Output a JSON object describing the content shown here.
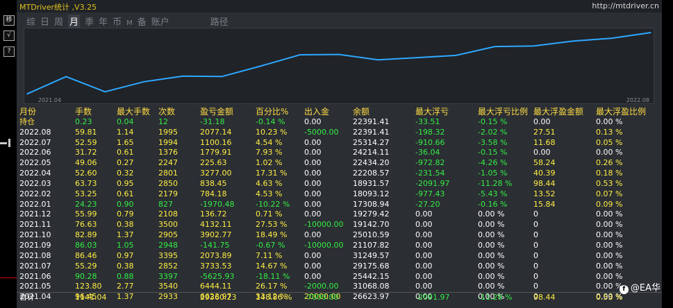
{
  "app": {
    "title": "MTDriver统计 ,V3.25",
    "link": "http://mtdriver.cn"
  },
  "rail_buttons": [
    "移",
    "√",
    "?"
  ],
  "tabs": [
    {
      "label": "综",
      "active": false
    },
    {
      "label": "日",
      "active": false
    },
    {
      "label": "周",
      "active": false
    },
    {
      "label": "月",
      "active": true
    },
    {
      "label": "季",
      "active": false
    },
    {
      "label": "年",
      "active": false
    },
    {
      "label": "币",
      "active": false
    },
    {
      "label": "M",
      "active": false
    },
    {
      "label": "备",
      "active": false
    },
    {
      "label": "账户",
      "active": false
    },
    {
      "label": "路径",
      "active": false
    }
  ],
  "chart_data": {
    "type": "line",
    "x_start_label": "2021.04",
    "x_end_label": "2022.08",
    "x": [
      "2021.04",
      "2021.05",
      "2021.06",
      "2021.07",
      "2021.08",
      "2021.09",
      "2021.10",
      "2021.11",
      "2021.12",
      "2022.01",
      "2022.02",
      "2022.03",
      "2022.04",
      "2022.05",
      "2022.06",
      "2022.07",
      "2022.08"
    ],
    "values": [
      6623.97,
      13068.08,
      7442.33,
      11175.86,
      13249.75,
      13108.0,
      17010.77,
      21142.88,
      21279.6,
      19309.12,
      20093.3,
      20931.75,
      24208.75,
      24434.38,
      26214.29,
      27314.4,
      29391.41
    ],
    "line_color": "#2ea8ff"
  },
  "table": {
    "headers": [
      "月份",
      "手数",
      "最大手数",
      "次数",
      "盈亏金额",
      "百分比%",
      "出入金",
      "余额",
      "最大浮亏",
      "最大浮亏比例",
      "最大浮盈金额",
      "最大浮盈比例"
    ],
    "rows": [
      {
        "cells": [
          "持仓",
          "0.23",
          "0.04",
          "12",
          "-31.18",
          "-0.14 %",
          "0.00",
          "22391.41",
          "-33.51",
          "-0.15 %",
          "0.00",
          "0.00 %"
        ],
        "colors": [
          "#ffdd44",
          "#33ee44",
          "#33ee44",
          "#33ee44",
          "#33ee44",
          "#33ee44",
          "#ffffff",
          "#ffffff",
          "#33ee44",
          "#33ee44",
          "#ffffff",
          "#ffffff"
        ]
      },
      {
        "cells": [
          "2022.08",
          "59.81",
          "1.14",
          "1995",
          "2077.14",
          "10.23 %",
          "-5000.00",
          "22391.41",
          "-198.32",
          "-2.02 %",
          "27.51",
          "0.13 %"
        ],
        "colors": [
          "#ffffff",
          "#ffee44",
          "#ffee44",
          "#ffee44",
          "#ffee44",
          "#ffee44",
          "#33ee44",
          "#ffffff",
          "#33ee44",
          "#33ee44",
          "#ffee44",
          "#ffee44"
        ]
      },
      {
        "cells": [
          "2022.07",
          "52.59",
          "1.65",
          "1994",
          "1100.16",
          "4.54 %",
          "0.00",
          "25314.27",
          "-910.66",
          "-3.58 %",
          "11.68",
          "0.05 %"
        ],
        "colors": [
          "#ffffff",
          "#ffee44",
          "#ffee44",
          "#ffee44",
          "#ffee44",
          "#ffee44",
          "#ffffff",
          "#ffffff",
          "#33ee44",
          "#33ee44",
          "#ffee44",
          "#ffee44"
        ]
      },
      {
        "cells": [
          "2022.06",
          "31.72",
          "0.61",
          "1376",
          "1779.91",
          "7.93 %",
          "0.00",
          "24214.11",
          "-36.04",
          "-0.15 %",
          "0.00",
          "0.00 %"
        ],
        "colors": [
          "#ffffff",
          "#ffee44",
          "#ffee44",
          "#ffee44",
          "#ffee44",
          "#ffee44",
          "#ffffff",
          "#ffffff",
          "#33ee44",
          "#33ee44",
          "#ffffff",
          "#ffffff"
        ]
      },
      {
        "cells": [
          "2022.05",
          "49.06",
          "0.27",
          "2247",
          "225.63",
          "1.02 %",
          "0.00",
          "22434.20",
          "-972.82",
          "-4.26 %",
          "58.24",
          "0.26 %"
        ],
        "colors": [
          "#ffffff",
          "#ffee44",
          "#ffee44",
          "#ffee44",
          "#ffee44",
          "#ffee44",
          "#ffffff",
          "#ffffff",
          "#33ee44",
          "#33ee44",
          "#ffee44",
          "#ffee44"
        ]
      },
      {
        "cells": [
          "2022.04",
          "52.60",
          "0.32",
          "2801",
          "3277.00",
          "17.31 %",
          "0.00",
          "22208.57",
          "-231.54",
          "-1.05 %",
          "40.39",
          "0.18 %"
        ],
        "colors": [
          "#ffffff",
          "#ffee44",
          "#ffee44",
          "#ffee44",
          "#ffee44",
          "#ffee44",
          "#ffffff",
          "#ffffff",
          "#33ee44",
          "#33ee44",
          "#ffee44",
          "#ffee44"
        ]
      },
      {
        "cells": [
          "2022.03",
          "63.73",
          "0.95",
          "2850",
          "838.45",
          "4.63 %",
          "0.00",
          "18931.57",
          "-2091.97",
          "-11.28 %",
          "98.44",
          "0.53 %"
        ],
        "colors": [
          "#ffffff",
          "#ffee44",
          "#ffee44",
          "#ffee44",
          "#ffee44",
          "#ffee44",
          "#ffffff",
          "#ffffff",
          "#33ee44",
          "#33ee44",
          "#ffee44",
          "#ffee44"
        ]
      },
      {
        "cells": [
          "2022.02",
          "53.25",
          "0.61",
          "2179",
          "784.18",
          "4.53 %",
          "0.00",
          "18093.12",
          "-977.43",
          "-5.43 %",
          "13.52",
          "0.07 %"
        ],
        "colors": [
          "#ffffff",
          "#ffee44",
          "#ffee44",
          "#ffee44",
          "#ffee44",
          "#ffee44",
          "#ffffff",
          "#ffffff",
          "#33ee44",
          "#33ee44",
          "#ffee44",
          "#ffee44"
        ]
      },
      {
        "cells": [
          "2022.01",
          "24.23",
          "0.90",
          "827",
          "-1970.48",
          "-10.22 %",
          "0.00",
          "17308.94",
          "-27.20",
          "-0.16 %",
          "15.84",
          "0.09 %"
        ],
        "colors": [
          "#ffffff",
          "#33ee44",
          "#33ee44",
          "#33ee44",
          "#33ee44",
          "#33ee44",
          "#ffffff",
          "#ffffff",
          "#33ee44",
          "#33ee44",
          "#ffee44",
          "#ffee44"
        ]
      },
      {
        "cells": [
          "2021.12",
          "55.99",
          "0.79",
          "2108",
          "136.72",
          "0.71 %",
          "0.00",
          "19279.42",
          "0.00",
          "0.00 %",
          "0",
          "0.00 %"
        ],
        "colors": [
          "#ffffff",
          "#ffee44",
          "#ffee44",
          "#ffee44",
          "#ffee44",
          "#ffee44",
          "#ffffff",
          "#ffffff",
          "#ffffff",
          "#ffffff",
          "#ffffff",
          "#ffffff"
        ]
      },
      {
        "cells": [
          "2021.11",
          "76.63",
          "0.38",
          "3500",
          "4132.11",
          "27.53 %",
          "-10000.00",
          "19142.70",
          "0.00",
          "0.00 %",
          "0",
          "0.00 %"
        ],
        "colors": [
          "#ffffff",
          "#ffee44",
          "#ffee44",
          "#ffee44",
          "#ffee44",
          "#ffee44",
          "#33ee44",
          "#ffffff",
          "#ffffff",
          "#ffffff",
          "#ffffff",
          "#ffffff"
        ]
      },
      {
        "cells": [
          "2021.10",
          "82.89",
          "1.37",
          "2905",
          "3902.77",
          "18.49 %",
          "0.00",
          "25010.59",
          "0.00",
          "0.00 %",
          "0",
          "0.00 %"
        ],
        "colors": [
          "#ffffff",
          "#ffee44",
          "#ffee44",
          "#ffee44",
          "#ffee44",
          "#ffee44",
          "#ffffff",
          "#ffffff",
          "#ffffff",
          "#ffffff",
          "#ffffff",
          "#ffffff"
        ]
      },
      {
        "cells": [
          "2021.09",
          "86.03",
          "1.05",
          "2948",
          "-141.75",
          "-0.67 %",
          "-10000.00",
          "21107.82",
          "0.00",
          "0.00 %",
          "0",
          "0.00 %"
        ],
        "colors": [
          "#ffffff",
          "#33ee44",
          "#33ee44",
          "#33ee44",
          "#33ee44",
          "#33ee44",
          "#33ee44",
          "#ffffff",
          "#ffffff",
          "#ffffff",
          "#ffffff",
          "#ffffff"
        ]
      },
      {
        "cells": [
          "2021.08",
          "86.46",
          "0.97",
          "3395",
          "2073.89",
          "7.11 %",
          "0.00",
          "31249.57",
          "0.00",
          "0.00 %",
          "0",
          "0.00 %"
        ],
        "colors": [
          "#ffffff",
          "#ffee44",
          "#ffee44",
          "#ffee44",
          "#ffee44",
          "#ffee44",
          "#ffffff",
          "#ffffff",
          "#ffffff",
          "#ffffff",
          "#ffffff",
          "#ffffff"
        ]
      },
      {
        "cells": [
          "2021.07",
          "55.29",
          "0.38",
          "2852",
          "3733.53",
          "14.67 %",
          "0.00",
          "29175.68",
          "0.00",
          "0.00 %",
          "0",
          "0.00 %"
        ],
        "colors": [
          "#ffffff",
          "#ffee44",
          "#ffee44",
          "#ffee44",
          "#ffee44",
          "#ffee44",
          "#ffffff",
          "#ffffff",
          "#ffffff",
          "#ffffff",
          "#ffffff",
          "#ffffff"
        ]
      },
      {
        "cells": [
          "2021.06",
          "90.28",
          "0.88",
          "3397",
          "-5625.93",
          "-18.11 %",
          "0.00",
          "25442.15",
          "0.00",
          "0.00 %",
          "0",
          "0.00 %"
        ],
        "colors": [
          "#ffffff",
          "#33ee44",
          "#33ee44",
          "#33ee44",
          "#33ee44",
          "#33ee44",
          "#ffffff",
          "#ffffff",
          "#ffffff",
          "#ffffff",
          "#ffffff",
          "#ffffff"
        ]
      },
      {
        "cells": [
          "2021.05",
          "123.80",
          "2.77",
          "3540",
          "6444.11",
          "26.17 %",
          "-2000.00",
          "31068.08",
          "0.00",
          "0.00 %",
          "0",
          "0.00 %"
        ],
        "colors": [
          "#ffffff",
          "#ffee44",
          "#ffee44",
          "#ffee44",
          "#ffee44",
          "#ffee44",
          "#33ee44",
          "#ffffff",
          "#ffffff",
          "#ffffff",
          "#ffffff",
          "#ffffff"
        ]
      },
      {
        "cells": [
          "2021.04",
          "96.45",
          "1.37",
          "2933",
          "6623.97",
          "33.12 %",
          "20000.00",
          "26623.97",
          "0.00",
          "0.00 %",
          "0",
          "0.00 %"
        ],
        "colors": [
          "#ffffff",
          "#ffee44",
          "#ffee44",
          "#ffee44",
          "#ffee44",
          "#ffee44",
          "#ffee44",
          "#ffffff",
          "#ffffff",
          "#ffffff",
          "#ffffff",
          "#ffffff"
        ]
      }
    ],
    "total": {
      "cells": [
        "合计",
        "1141.04",
        "",
        "",
        "29360.23",
        "148.86 %",
        "-7000.00",
        "",
        "-2091.97",
        "-11.28 %",
        "98.44",
        "0.53 %"
      ],
      "colors": [
        "#ffffff",
        "#ffee44",
        "#ffee44",
        "#ffee44",
        "#ffee44",
        "#ffee44",
        "#33ee44",
        "#ffffff",
        "#33ee44",
        "#33ee44",
        "#ffee44",
        "#ffee44"
      ]
    }
  },
  "watermark": {
    "text": "@EA华"
  }
}
